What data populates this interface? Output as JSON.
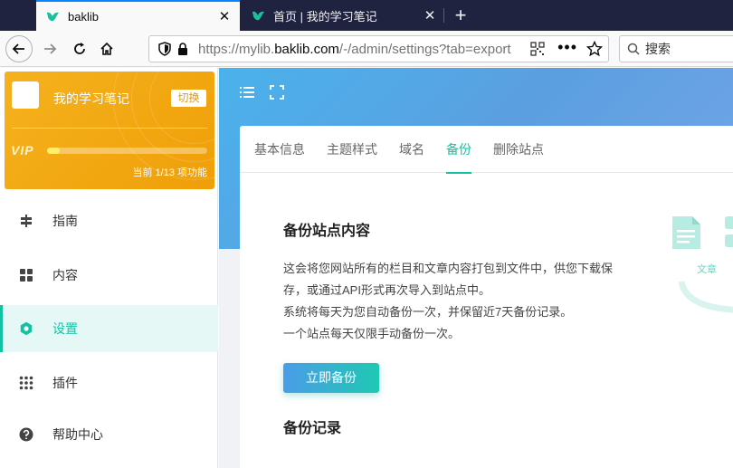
{
  "browser": {
    "tabs": [
      {
        "title": "baklib",
        "active": true
      },
      {
        "title": "首页 | 我的学习笔记",
        "active": false
      }
    ],
    "url": {
      "prefix": "https://mylib.",
      "host": "baklib.com",
      "path": "/-/admin/settings?tab=export"
    },
    "search_placeholder": "搜索"
  },
  "sidebar": {
    "site_name": "我的学习笔记",
    "switch_label": "切换",
    "vip_label": "VIP",
    "vip_progress": 0.0769,
    "vip_status": "当前 1/13 项功能",
    "items": [
      {
        "label": "指南",
        "icon": "signpost-icon",
        "active": false
      },
      {
        "label": "内容",
        "icon": "grid-icon",
        "active": false
      },
      {
        "label": "设置",
        "icon": "gear-icon",
        "active": true
      },
      {
        "label": "插件",
        "icon": "dots-grid-icon",
        "active": false
      },
      {
        "label": "帮助中心",
        "icon": "help-icon",
        "active": false
      }
    ]
  },
  "main": {
    "tabs": [
      {
        "label": "基本信息",
        "active": false
      },
      {
        "label": "主题样式",
        "active": false
      },
      {
        "label": "域名",
        "active": false
      },
      {
        "label": "备份",
        "active": true
      },
      {
        "label": "删除站点",
        "active": false
      }
    ],
    "backup_title": "备份站点内容",
    "description": [
      "这会将您网站所有的栏目和文章内容打包到文件中，供您下载保",
      "存，或通过API形式再次导入到站点中。",
      "系统将每天为您自动备份一次，并保留近7天备份记录。",
      "一个站点每天仅限手动备份一次。"
    ],
    "backup_button": "立即备份",
    "records_title": "备份记录",
    "illustration_label": "文章"
  },
  "colors": {
    "accent": "#13c2a3",
    "vip_card": "#f2a812",
    "banner": "#5aa6e6",
    "tab_strip": "#202340"
  }
}
